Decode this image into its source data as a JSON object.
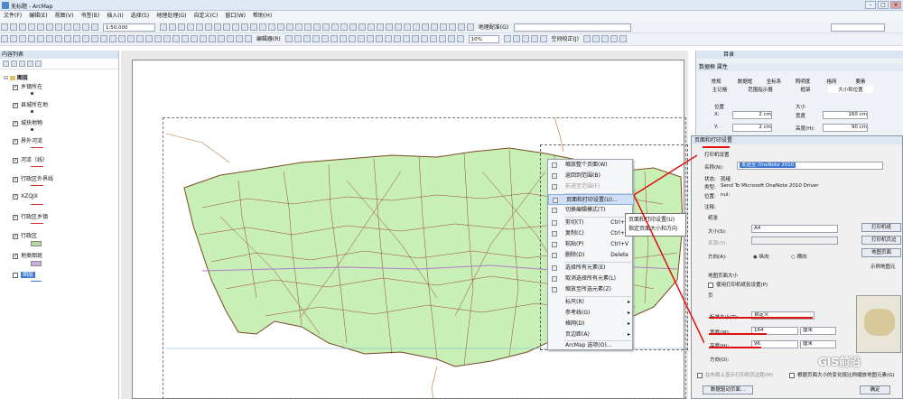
{
  "window": {
    "title": "无标题 - ArcMap",
    "min": "–",
    "max": "□",
    "close": "×"
  },
  "menu": [
    "文件(F)",
    "编辑(E)",
    "视图(V)",
    "书签(B)",
    "插入(I)",
    "选择(S)",
    "地理处理(G)",
    "自定义(C)",
    "窗口(W)",
    "帮助(H)"
  ],
  "toolbar": {
    "scale": "1:50,000",
    "georef_label": "地理配准(G)",
    "editor": "编辑器(R)",
    "zoom_pct": "10%",
    "space_adjust": "空间校正(J)"
  },
  "toc": {
    "title": "内容列表",
    "layers_root": "图层",
    "layers": [
      "乡镇所在",
      "县城所在地",
      "城抉地物",
      "界外河流",
      "河流（线）",
      "行政区外界线",
      "XZQJX",
      "行政区乡镇",
      "行政区",
      "地类图斑",
      "图层"
    ]
  },
  "context_menu": {
    "items": [
      {
        "label": "缩放整个页面(W)",
        "shortcut": ""
      },
      {
        "label": "返回到范围(B)",
        "shortcut": ""
      },
      {
        "label": "前进至范围(F)",
        "shortcut": ""
      },
      {
        "label": "页面和打印设置(U)...",
        "shortcut": ""
      },
      {
        "label": "切换编辑模式(T)",
        "shortcut": ""
      },
      {
        "label": "剪切(T)",
        "shortcut": "Ctrl+X"
      },
      {
        "label": "复制(C)",
        "shortcut": "Ctrl+C"
      },
      {
        "label": "粘贴(P)",
        "shortcut": "Ctrl+V"
      },
      {
        "label": "删除(D)",
        "shortcut": "Delete"
      },
      {
        "label": "选择所有元素(E)",
        "shortcut": ""
      },
      {
        "label": "取消选择所有元素(L)",
        "shortcut": ""
      },
      {
        "label": "缩放至所选元素(Z)",
        "shortcut": ""
      },
      {
        "label": "标尺(R)",
        "shortcut": ""
      },
      {
        "label": "参考线(G)",
        "shortcut": ""
      },
      {
        "label": "格网(D)",
        "shortcut": ""
      },
      {
        "label": "页边距(A)",
        "shortcut": ""
      },
      {
        "label": "ArcMap 选项(O)...",
        "shortcut": ""
      }
    ],
    "tooltip_title": "页面和打印设置(U)",
    "tooltip_body": "指定页面大小和方向"
  },
  "right_panel": {
    "title": "目录",
    "frame_title": "数据框 属性",
    "tabs_row1": [
      "常规",
      "数据框",
      "坐标系",
      "照明度",
      "格网",
      "要素"
    ],
    "tabs_row2": [
      "主记格",
      "范围指示器",
      "框架",
      "大小和位置"
    ],
    "position_label": "位置",
    "size_label": "大小",
    "x_label": "X:",
    "x_val": "2 cm",
    "y_label": "Y:",
    "y_val": "2 cm",
    "width_label": "宽度",
    "width_val": "160 cm",
    "height_label": "高度(H):",
    "height_val": "90 cm"
  },
  "page_setup": {
    "title": "页面和打印设置",
    "printer_group": "打印机设置",
    "name_label": "名称(N):",
    "printer_name": "发送至 OneNote 2010",
    "status_label": "状态:",
    "status_val": "就绪",
    "type_label": "类型:",
    "type_val": "Send To Microsoft OneNote 2010 Driver",
    "location_label": "位置:",
    "location_val": "nul:",
    "comment_label": "注释:",
    "paper_group": "纸张",
    "size_label": "大小(S):",
    "size_val": "A4",
    "source_label": "来源(O):",
    "orient_label": "方向(A):",
    "portrait": "纵向",
    "landscape": "横向",
    "printer_btn": "打印机纸",
    "print_btn": "打印机页边",
    "map_page_btn": "地图页面",
    "sample_label": "示例地图元",
    "map_page_group": "地图页面大小",
    "use_printer": "使用打印机纸张设置(P)",
    "page_label": "页",
    "std_size_label": "标准大小(Z):",
    "std_size_val": "自定义",
    "width_label": "宽度(W):",
    "width_val": "164",
    "width_unit": "厘米",
    "height_label": "高度(H):",
    "height_val": "96",
    "height_unit": "厘米",
    "orient2_label": "方向(O):",
    "print_layout_label": "在布局上显示打印机页边距(M)",
    "scale_label": "根据页面大小的变化按比例缩放地图元素(G)",
    "data_driven_btn": "数据驱动页面...",
    "ok_btn": "确定"
  },
  "watermark": "GIS前沿"
}
